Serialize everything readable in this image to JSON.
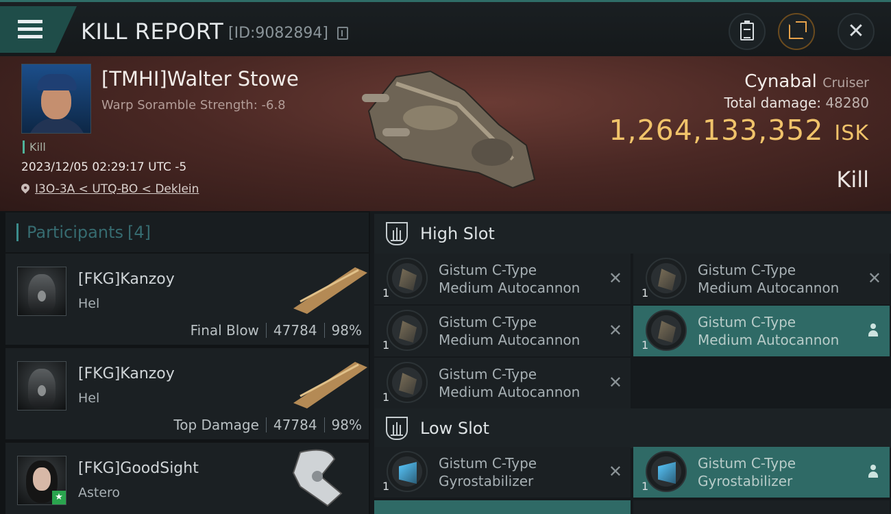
{
  "header": {
    "title": "KILL REPORT",
    "report_id": "[ID:9082894]",
    "icons": [
      "menu-icon",
      "copy-icon",
      "clipboard-icon",
      "share-icon",
      "close-icon"
    ]
  },
  "victim": {
    "name": "[TMHI]Walter Stowe",
    "subtitle": "Warp Soramble Strength: -6.8",
    "tag": "Kill",
    "timestamp": "2023/12/05 02:29:17 UTC -5",
    "location": "I3O-3A < UTQ-BO < Deklein",
    "ship_name": "Cynabal",
    "ship_class": "Cruiser",
    "total_damage_label": "Total damage:",
    "total_damage": "48280",
    "isk_value": "1,264,133,352",
    "isk_unit": "ISK",
    "result": "Kill"
  },
  "participants": {
    "title": "Participants",
    "count": "[4]",
    "rows": [
      {
        "name": "[FKG]Kanzoy",
        "ship": "Hel",
        "role": "Final Blow",
        "damage": "47784",
        "percent": "98%"
      },
      {
        "name": "[FKG]Kanzoy",
        "ship": "Hel",
        "role": "Top Damage",
        "damage": "47784",
        "percent": "98%"
      },
      {
        "name": "[FKG]GoodSight",
        "ship": "Astero",
        "role": "",
        "damage": "",
        "percent": ""
      }
    ]
  },
  "slots": {
    "high": {
      "label": "High Slot",
      "modules": [
        {
          "qty": "1",
          "line1": "Gistum C-Type",
          "line2": "Medium Autocannon",
          "state": "destroyed"
        },
        {
          "qty": "1",
          "line1": "Gistum C-Type",
          "line2": "Medium Autocannon",
          "state": "destroyed"
        },
        {
          "qty": "1",
          "line1": "Gistum C-Type",
          "line2": "Medium Autocannon",
          "state": "destroyed"
        },
        {
          "qty": "1",
          "line1": "Gistum C-Type",
          "line2": "Medium Autocannon",
          "state": "dropped"
        },
        {
          "qty": "1",
          "line1": "Gistum C-Type",
          "line2": "Medium Autocannon",
          "state": "destroyed"
        }
      ]
    },
    "low": {
      "label": "Low Slot",
      "modules": [
        {
          "qty": "1",
          "line1": "Gistum C-Type",
          "line2": "Gyrostabilizer",
          "state": "destroyed"
        },
        {
          "qty": "1",
          "line1": "Gistum C-Type",
          "line2": "Gyrostabilizer",
          "state": "dropped"
        }
      ]
    }
  },
  "colors": {
    "accent": "#2f6a66",
    "isk": "#f0c36a",
    "banner": "#4a2824"
  }
}
